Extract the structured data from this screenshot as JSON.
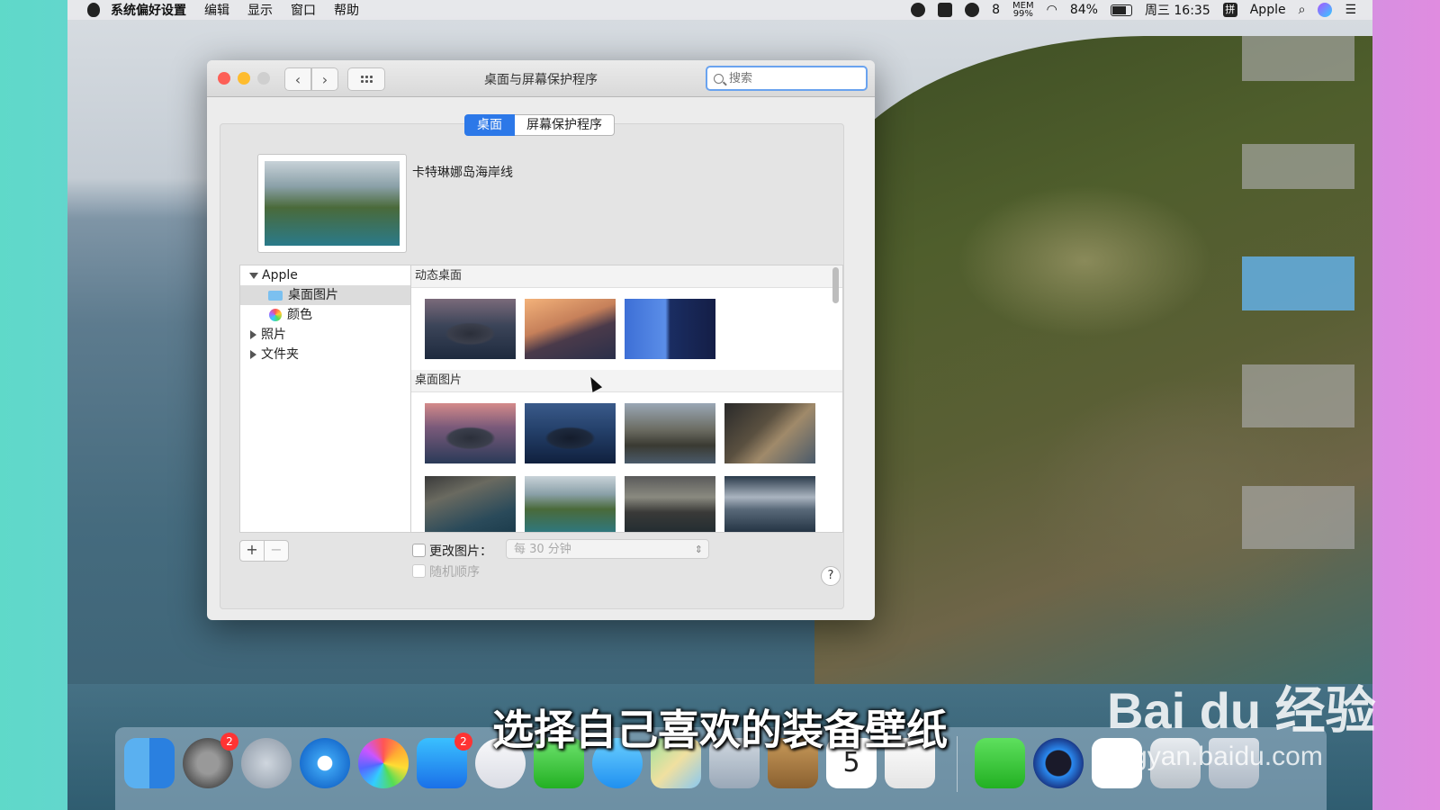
{
  "menubar": {
    "app_name": "系统偏好设置",
    "menus": [
      "编辑",
      "显示",
      "窗口",
      "帮助"
    ],
    "wechat_count": "8",
    "mem_label": "MEM",
    "mem_value": "99%",
    "battery": "84%",
    "datetime": "周三 16:35",
    "input_method": "拼",
    "user": "Apple"
  },
  "window": {
    "title": "桌面与屏幕保护程序",
    "search_placeholder": "搜索",
    "tabs": [
      {
        "label": "桌面",
        "active": true
      },
      {
        "label": "屏幕保护程序",
        "active": false
      }
    ],
    "current_wallpaper_name": "卡特琳娜岛海岸线",
    "sidebar": [
      {
        "label": "Apple",
        "expanded": true
      },
      {
        "label": "桌面图片",
        "selected": true
      },
      {
        "label": "颜色"
      },
      {
        "label": "照片",
        "expanded": false
      },
      {
        "label": "文件夹",
        "expanded": false
      }
    ],
    "sections": [
      {
        "title": "动态桌面",
        "thumbs": [
          "dark-island",
          "dune",
          "gradient"
        ]
      },
      {
        "title": "桌面图片",
        "thumbs": [
          "sunset-island",
          "night-island",
          "mountain",
          "cliff",
          "rocks",
          "coast",
          "cloudy",
          "storm"
        ]
      }
    ],
    "add_label": "+",
    "remove_label": "−",
    "change_picture_label": "更改图片：",
    "interval": "每 30 分钟",
    "random_order_label": "随机顺序",
    "help_label": "?"
  },
  "dock": {
    "badges": {
      "system_prefs": "2",
      "app_store": "2",
      "calendar_day": "5"
    }
  },
  "caption": "选择自己喜欢的装备壁纸",
  "watermark": {
    "logo": "Bai du 经验",
    "url": "jingyan.baidu.com"
  },
  "colors": {
    "accent": "#2c78e8",
    "close": "#fd5f57",
    "minimize": "#febc2e"
  }
}
